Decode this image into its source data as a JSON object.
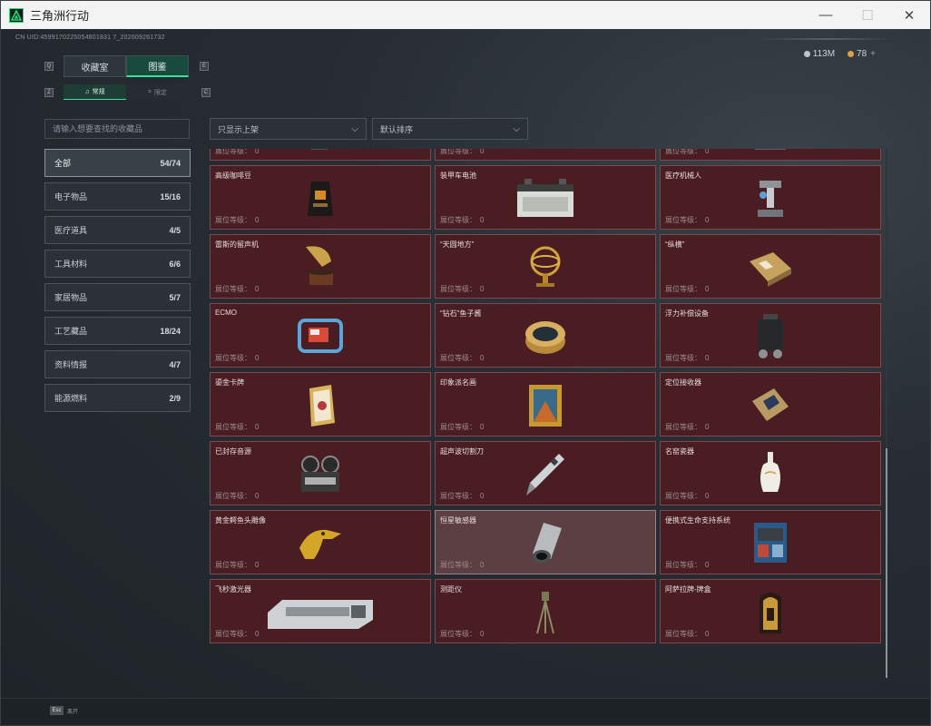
{
  "window": {
    "title": "三角洲行动",
    "minimize": "—",
    "maximize": "☐",
    "close": "✕"
  },
  "header": {
    "uid": "CN UID:4599170225054801831 7_202609261732",
    "currency": [
      {
        "icon": "silver-coin-icon",
        "value": "113M"
      },
      {
        "icon": "gold-coin-icon",
        "value": "78",
        "plus": "+"
      }
    ]
  },
  "keys": {
    "tab_prev": "Q",
    "tab_next": "E",
    "sub_prev": "Z",
    "sub_next": "C"
  },
  "tabs": [
    {
      "label": "收藏室",
      "active": false
    },
    {
      "label": "图鉴",
      "active": true
    }
  ],
  "subtabs": [
    {
      "label": "常规",
      "icon": "♫",
      "active": true
    },
    {
      "label": "限定",
      "icon": "⌗",
      "active": false
    }
  ],
  "search": {
    "placeholder": "请输入想要查找的收藏品"
  },
  "filters": {
    "display": {
      "label": "只显示上架",
      "chevron": "⌵"
    },
    "sort": {
      "label": "默认排序",
      "chevron": "⌵"
    }
  },
  "categories": [
    {
      "label": "全部",
      "count": "54/74",
      "active": true
    },
    {
      "label": "电子物品",
      "count": "15/16"
    },
    {
      "label": "医疗道具",
      "count": "4/5"
    },
    {
      "label": "工具材料",
      "count": "6/6"
    },
    {
      "label": "家居物品",
      "count": "5/7"
    },
    {
      "label": "工艺藏品",
      "count": "18/24"
    },
    {
      "label": "资料情报",
      "count": "4/7"
    },
    {
      "label": "能源燃料",
      "count": "2/9"
    }
  ],
  "level_label": "展位等级：",
  "items": [
    {
      "name": "",
      "level": "0",
      "icon": "vacuum-cleaner-icon"
    },
    {
      "name": "",
      "level": "0",
      "icon": "server-icon"
    },
    {
      "name": "",
      "level": "0",
      "icon": "robot-mop-icon"
    },
    {
      "name": "高级咖啡豆",
      "level": "0",
      "icon": "coffee-bag-icon"
    },
    {
      "name": "装甲车电池",
      "level": "0",
      "icon": "battery-icon"
    },
    {
      "name": "医疗机械人",
      "level": "0",
      "icon": "medical-robot-icon"
    },
    {
      "name": "雷斯的留声机",
      "level": "0",
      "icon": "gramophone-icon"
    },
    {
      "name": "“天圆地方”",
      "level": "0",
      "icon": "armillary-icon"
    },
    {
      "name": "“纵横”",
      "level": "0",
      "icon": "chessboard-icon"
    },
    {
      "name": "ECMO",
      "level": "0",
      "icon": "ecmo-icon"
    },
    {
      "name": "“钻石”鱼子酱",
      "level": "0",
      "icon": "caviar-tin-icon"
    },
    {
      "name": "浮力补偿设备",
      "level": "0",
      "icon": "buoyancy-device-icon"
    },
    {
      "name": "鎏金卡牌",
      "level": "0",
      "icon": "gilded-card-icon"
    },
    {
      "name": "印象派名画",
      "level": "0",
      "icon": "painting-icon"
    },
    {
      "name": "定位接收器",
      "level": "0",
      "icon": "receiver-icon"
    },
    {
      "name": "已封存音源",
      "level": "0",
      "icon": "tape-recorder-icon"
    },
    {
      "name": "超声波切割刀",
      "level": "0",
      "icon": "ultrasonic-knife-icon"
    },
    {
      "name": "名窑瓷器",
      "level": "0",
      "icon": "porcelain-vase-icon"
    },
    {
      "name": "黄金鳄鱼头雕像",
      "level": "0",
      "icon": "gold-crocodile-icon"
    },
    {
      "name": "恒星敏感器",
      "level": "0",
      "icon": "star-sensor-icon",
      "highlight": true
    },
    {
      "name": "便携式生命支持系统",
      "level": "0",
      "icon": "life-support-icon"
    },
    {
      "name": "飞秒激光器",
      "level": "0",
      "icon": "femto-laser-icon"
    },
    {
      "name": "测距仪",
      "level": "0",
      "icon": "rangefinder-icon"
    },
    {
      "name": "阿萨拉牌-牌盒",
      "level": "0",
      "icon": "card-box-icon"
    }
  ],
  "footer": {
    "key": "Esc",
    "label": "离开"
  }
}
